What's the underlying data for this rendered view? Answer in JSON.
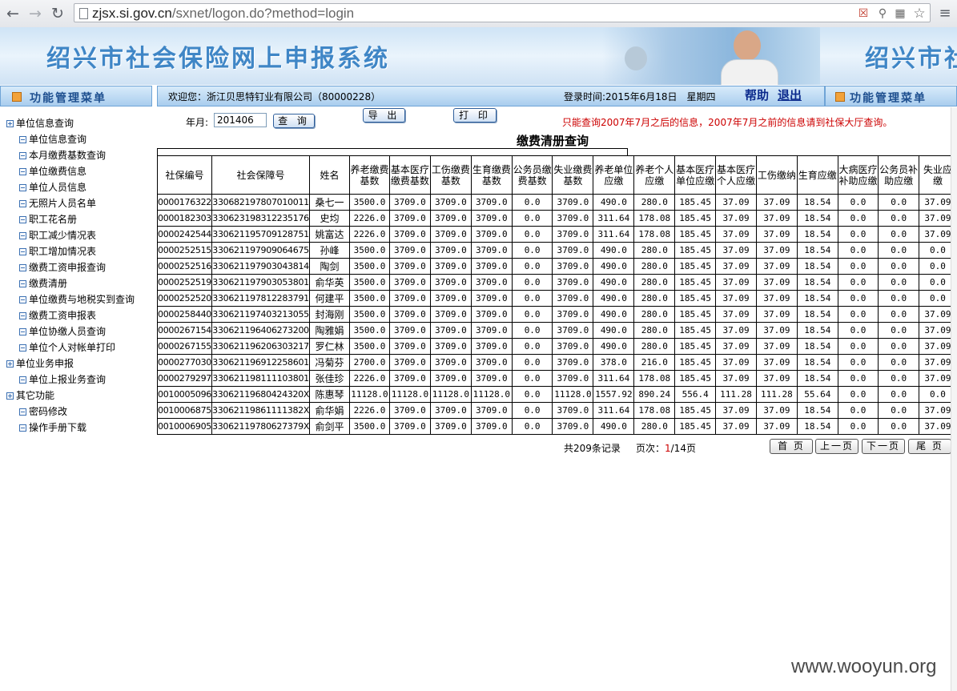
{
  "browser": {
    "url_host": "zjsx.si.gov.cn",
    "url_path": "/sxnet/logon.do?method=login"
  },
  "banner": {
    "title": "绍兴市社会保险网上申报系统",
    "title_repeat": "绍兴市社"
  },
  "menubar": {
    "left_label": "功能管理菜单",
    "welcome": "欢迎您：浙江贝思特钉业有限公司（80000228）",
    "login_time": "登录时间:2015年6月18日　星期四",
    "help": "帮助",
    "logout": "退出",
    "right_label": "功能管理菜单"
  },
  "sidebar": {
    "groups": [
      {
        "label": "单位信息查询",
        "items": [
          "单位信息查询",
          "本月缴费基数查询",
          "单位缴费信息",
          "单位人员信息",
          "无照片人员名单",
          "职工花名册",
          "职工减少情况表",
          "职工增加情况表",
          "缴费工资申报查询",
          "缴费清册",
          "单位缴费与地税实到查询",
          "缴费工资申报表",
          "单位协缴人员查询",
          "单位个人对帐单打印"
        ]
      },
      {
        "label": "单位业务申报",
        "items": [
          "单位上报业务查询"
        ]
      },
      {
        "label": "其它功能",
        "items": [
          "密码修改",
          "操作手册下载"
        ]
      }
    ]
  },
  "search": {
    "month_label": "年月:",
    "month_value": "201406",
    "query_button": "查 询",
    "export_button": "导 出",
    "print_button": "打 印",
    "notice": "只能查询2007年7月之后的信息，2007年7月之前的信息请到社保大厅查询。"
  },
  "table": {
    "title": "缴费清册查询",
    "headers": [
      "社保编号",
      "社会保障号",
      "姓名",
      "养老缴费基数",
      "基本医疗缴费基数",
      "工伤缴费基数",
      "生育缴费基数",
      "公务员缴费基数",
      "失业缴费基数",
      "养老单位应缴",
      "养老个人应缴",
      "基本医疗单位应缴",
      "基本医疗个人应缴",
      "工伤缴纳",
      "生育应缴",
      "大病医疗补助应缴",
      "公务员补助应缴",
      "失业应缴"
    ],
    "rows": [
      [
        "0000176322",
        "330682197807010011",
        "桑七一",
        "3500.0",
        "3709.0",
        "3709.0",
        "3709.0",
        "0.0",
        "3709.0",
        "490.0",
        "280.0",
        "185.45",
        "37.09",
        "37.09",
        "18.54",
        "0.0",
        "0.0",
        "37.09"
      ],
      [
        "0000182303",
        "330623198312235176",
        "史均",
        "2226.0",
        "3709.0",
        "3709.0",
        "3709.0",
        "0.0",
        "3709.0",
        "311.64",
        "178.08",
        "185.45",
        "37.09",
        "37.09",
        "18.54",
        "0.0",
        "0.0",
        "37.09"
      ],
      [
        "0000242544",
        "330621195709128751",
        "姚富达",
        "2226.0",
        "3709.0",
        "3709.0",
        "3709.0",
        "0.0",
        "3709.0",
        "311.64",
        "178.08",
        "185.45",
        "37.09",
        "37.09",
        "18.54",
        "0.0",
        "0.0",
        "37.09"
      ],
      [
        "0000252515",
        "330621197909064675",
        "孙峰",
        "3500.0",
        "3709.0",
        "3709.0",
        "3709.0",
        "0.0",
        "3709.0",
        "490.0",
        "280.0",
        "185.45",
        "37.09",
        "37.09",
        "18.54",
        "0.0",
        "0.0",
        "0.0"
      ],
      [
        "0000252516",
        "330621197903043814",
        "陶剑",
        "3500.0",
        "3709.0",
        "3709.0",
        "3709.0",
        "0.0",
        "3709.0",
        "490.0",
        "280.0",
        "185.45",
        "37.09",
        "37.09",
        "18.54",
        "0.0",
        "0.0",
        "0.0"
      ],
      [
        "0000252519",
        "330621197903053801",
        "俞华英",
        "3500.0",
        "3709.0",
        "3709.0",
        "3709.0",
        "0.0",
        "3709.0",
        "490.0",
        "280.0",
        "185.45",
        "37.09",
        "37.09",
        "18.54",
        "0.0",
        "0.0",
        "0.0"
      ],
      [
        "0000252520",
        "330621197812283791",
        "何建平",
        "3500.0",
        "3709.0",
        "3709.0",
        "3709.0",
        "0.0",
        "3709.0",
        "490.0",
        "280.0",
        "185.45",
        "37.09",
        "37.09",
        "18.54",
        "0.0",
        "0.0",
        "0.0"
      ],
      [
        "0000258440",
        "330621197403213055",
        "封海刚",
        "3500.0",
        "3709.0",
        "3709.0",
        "3709.0",
        "0.0",
        "3709.0",
        "490.0",
        "280.0",
        "185.45",
        "37.09",
        "37.09",
        "18.54",
        "0.0",
        "0.0",
        "37.09"
      ],
      [
        "0000267154",
        "330621196406273200",
        "陶雅娟",
        "3500.0",
        "3709.0",
        "3709.0",
        "3709.0",
        "0.0",
        "3709.0",
        "490.0",
        "280.0",
        "185.45",
        "37.09",
        "37.09",
        "18.54",
        "0.0",
        "0.0",
        "37.09"
      ],
      [
        "0000267155",
        "330621196206303217",
        "罗仁林",
        "3500.0",
        "3709.0",
        "3709.0",
        "3709.0",
        "0.0",
        "3709.0",
        "490.0",
        "280.0",
        "185.45",
        "37.09",
        "37.09",
        "18.54",
        "0.0",
        "0.0",
        "37.09"
      ],
      [
        "0000277030",
        "330621196912258601",
        "冯菊芬",
        "2700.0",
        "3709.0",
        "3709.0",
        "3709.0",
        "0.0",
        "3709.0",
        "378.0",
        "216.0",
        "185.45",
        "37.09",
        "37.09",
        "18.54",
        "0.0",
        "0.0",
        "37.09"
      ],
      [
        "0000279297",
        "330621198111103801",
        "张佳珍",
        "2226.0",
        "3709.0",
        "3709.0",
        "3709.0",
        "0.0",
        "3709.0",
        "311.64",
        "178.08",
        "185.45",
        "37.09",
        "37.09",
        "18.54",
        "0.0",
        "0.0",
        "37.09"
      ],
      [
        "0010005096",
        "33062119680424320X",
        "陈惠琴",
        "11128.0",
        "11128.0",
        "11128.0",
        "11128.0",
        "0.0",
        "11128.0",
        "1557.92",
        "890.24",
        "556.4",
        "111.28",
        "111.28",
        "55.64",
        "0.0",
        "0.0",
        "0.0"
      ],
      [
        "0010006875",
        "33062119861111382X",
        "俞华娟",
        "2226.0",
        "3709.0",
        "3709.0",
        "3709.0",
        "0.0",
        "3709.0",
        "311.64",
        "178.08",
        "185.45",
        "37.09",
        "37.09",
        "18.54",
        "0.0",
        "0.0",
        "37.09"
      ],
      [
        "0010006905",
        "33062119780627379X",
        "俞剑平",
        "3500.0",
        "3709.0",
        "3709.0",
        "3709.0",
        "0.0",
        "3709.0",
        "490.0",
        "280.0",
        "185.45",
        "37.09",
        "37.09",
        "18.54",
        "0.0",
        "0.0",
        "37.09"
      ]
    ]
  },
  "pager": {
    "total": "共209条记录",
    "page_label": "页次：",
    "current": "1",
    "total_pages": "/14页",
    "first": "首 页",
    "prev": "上一页",
    "next": "下一页",
    "last": "尾 页"
  },
  "watermark": "www.wooyun.org"
}
